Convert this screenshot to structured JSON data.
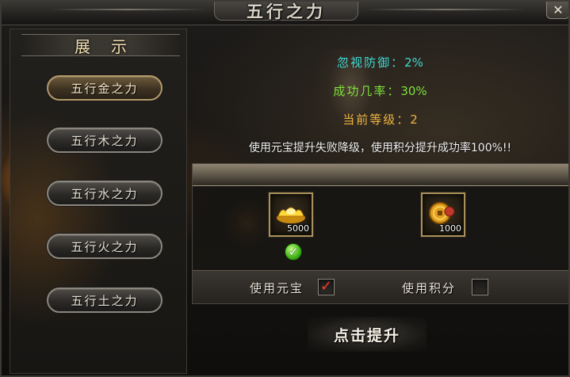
{
  "window": {
    "title": "五行之力",
    "close_label": "✕"
  },
  "sidebar": {
    "header": "展示",
    "tabs": [
      {
        "label": "五行金之力",
        "active": true
      },
      {
        "label": "五行木之力",
        "active": false
      },
      {
        "label": "五行水之力",
        "active": false
      },
      {
        "label": "五行火之力",
        "active": false
      },
      {
        "label": "五行土之力",
        "active": false
      }
    ]
  },
  "stats": {
    "ignore_defense": {
      "label": "忽视防御：",
      "value": "2%",
      "color": "#3fd9d2"
    },
    "success_rate": {
      "label": "成功几率：",
      "value": "30%",
      "color": "#7ee23a"
    },
    "current_level": {
      "label": "当前等级：",
      "value": "2",
      "color": "#f0b540"
    }
  },
  "notice": "使用元宝提升失败降级，使用积分提升成功率100%!!",
  "costs": {
    "yuanbao": {
      "icon": "gold-ingot-icon",
      "quantity": "5000",
      "selected": true
    },
    "points": {
      "icon": "coin-icon",
      "quantity": "1000",
      "selected": false
    }
  },
  "options": {
    "use_yuanbao": {
      "label": "使用元宝",
      "checked": true,
      "check_glyph": "✓"
    },
    "use_points": {
      "label": "使用积分",
      "checked": false
    }
  },
  "check_glyph": "✓",
  "upgrade_button": "点击提升"
}
